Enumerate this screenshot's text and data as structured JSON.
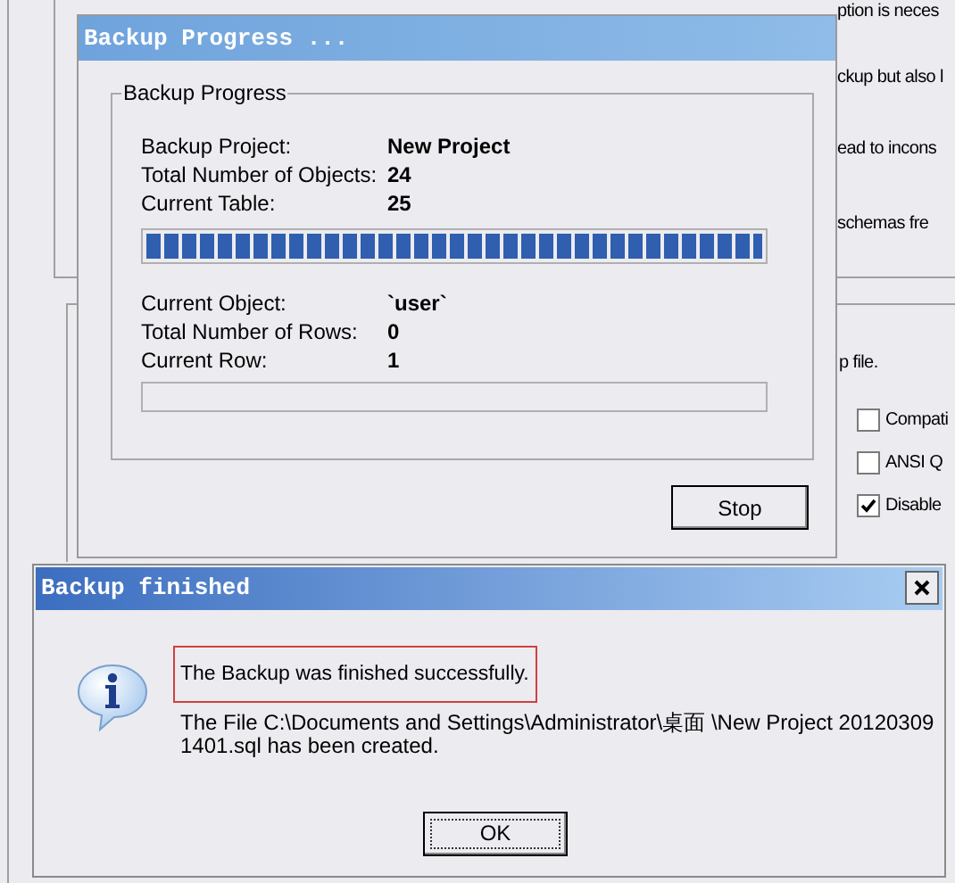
{
  "background": {
    "texts": [
      {
        "text": "ption is neces"
      },
      {
        "text": "ckup but also l"
      },
      {
        "text": "ead to incons"
      },
      {
        "text": "schemas fre"
      },
      {
        "text": "p file."
      }
    ],
    "options": [
      {
        "label": "Compati",
        "checked": false
      },
      {
        "label": "ANSI Q",
        "checked": false
      },
      {
        "label": "Disable",
        "checked": true
      }
    ]
  },
  "progress_dialog": {
    "title": "Backup Progress ...",
    "group_title": "Backup Progress",
    "fields": [
      {
        "label": "Backup Project:",
        "value": "New Project"
      },
      {
        "label": "Total Number of Objects:",
        "value": "24"
      },
      {
        "label": "Current Table:",
        "value": "25"
      }
    ],
    "table_progress": {
      "level": 1
    },
    "row_fields": [
      {
        "label": "Current Object:",
        "value": "`user`"
      },
      {
        "label": "Total Number of Rows:",
        "value": "0"
      },
      {
        "label": "Current Row:",
        "value": "1"
      }
    ],
    "row_progress": {
      "level": 0
    },
    "stop_button": "Stop"
  },
  "finished_dialog": {
    "title": "Backup finished",
    "message": "The Backup was finished successfully.",
    "detail_lines": [
      "The File C:\\Documents and Settings\\Administrator\\桌面 \\New Project 20120309",
      "1401.sql has been created."
    ],
    "ok_button": "OK"
  }
}
